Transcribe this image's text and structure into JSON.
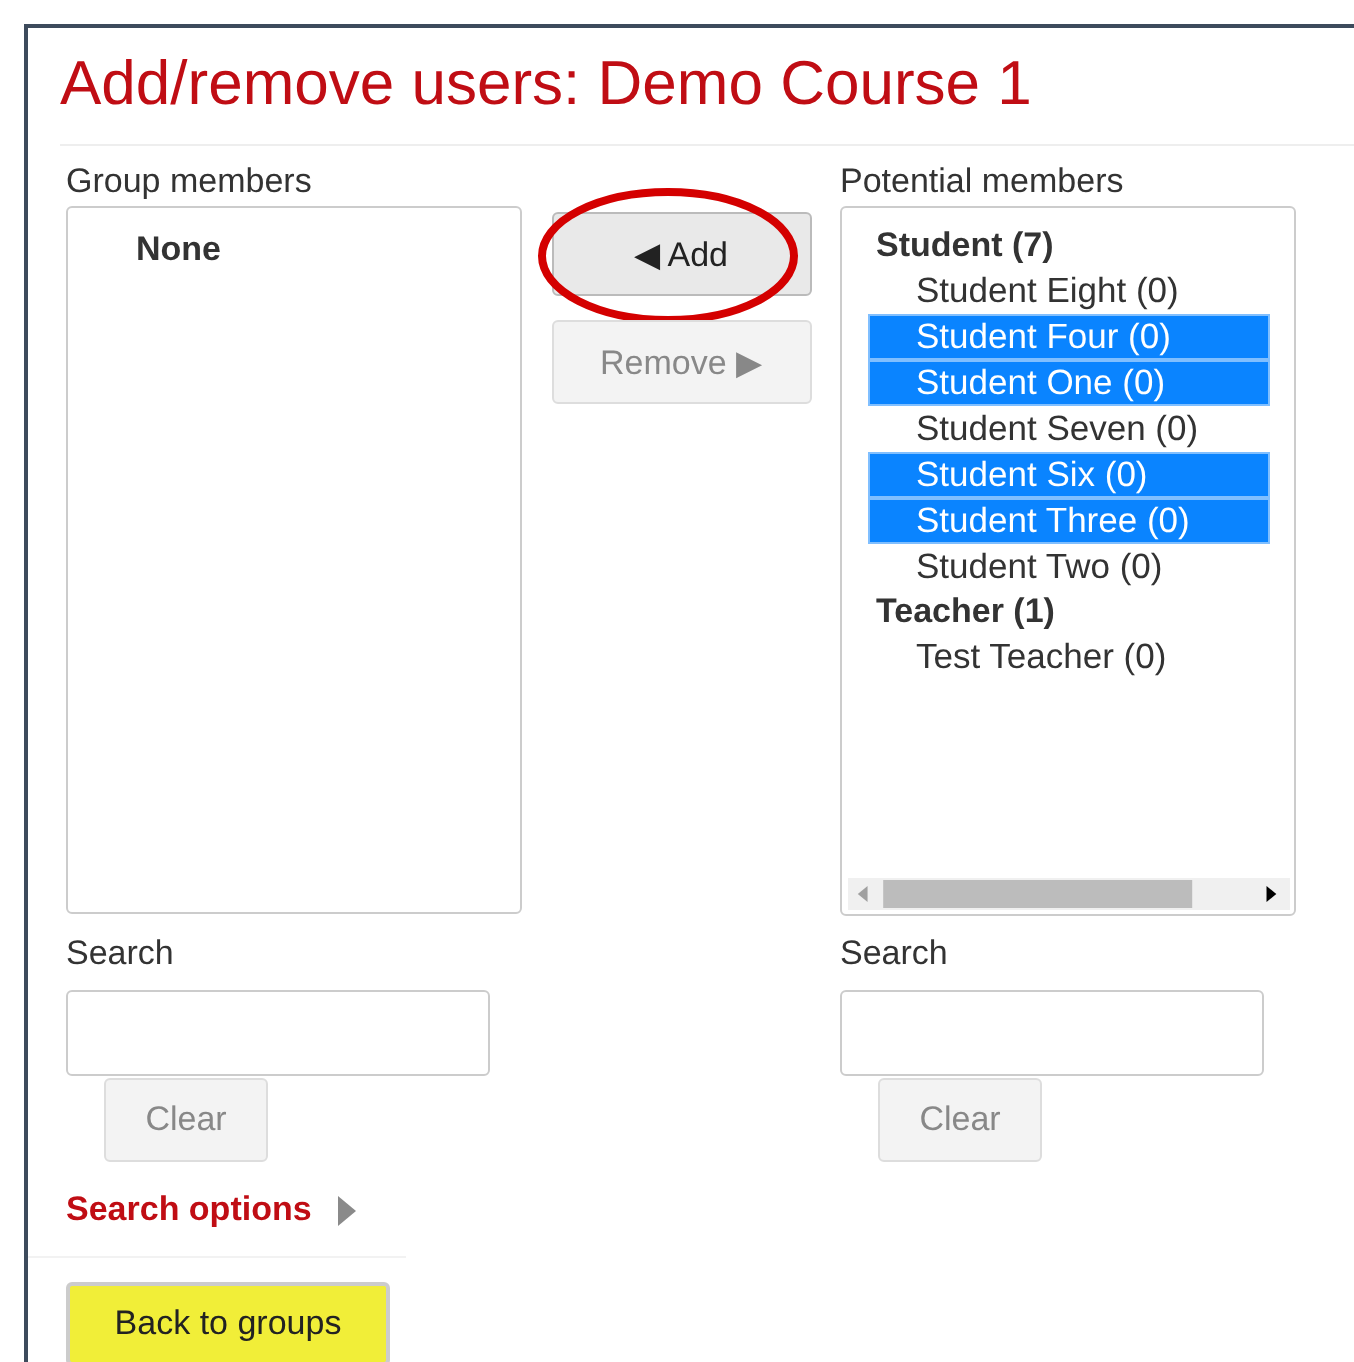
{
  "title": "Add/remove users: Demo Course 1",
  "group_members": {
    "label": "Group members",
    "groups": [
      {
        "label": "None"
      }
    ]
  },
  "actions": [
    {
      "label": "◀ Add",
      "disabled": false,
      "circled": true
    },
    {
      "label": "Remove ▶",
      "disabled": true,
      "circled": false
    }
  ],
  "potential_members": {
    "label": "Potential members",
    "groups": [
      {
        "label": "Student (7)",
        "options": [
          {
            "name": "Student Eight",
            "count": "(0)",
            "selected": false
          },
          {
            "name": "Student Four",
            "count": "(0)",
            "selected": true
          },
          {
            "name": "Student One",
            "count": "(0)",
            "selected": true
          },
          {
            "name": "Student Seven",
            "count": "(0)",
            "selected": false
          },
          {
            "name": "Student Six",
            "count": "(0)",
            "selected": true
          },
          {
            "name": "Student Three",
            "count": "(0)",
            "selected": true
          },
          {
            "name": "Student Two",
            "count": "(0)",
            "selected": false
          }
        ]
      },
      {
        "label": "Teacher (1)",
        "options": [
          {
            "name": "Test Teacher",
            "count": "(0)",
            "selected": false
          }
        ]
      }
    ]
  },
  "searches": [
    {
      "label": "Search",
      "clear": "Clear"
    },
    {
      "label": "Search",
      "clear": "Clear"
    }
  ],
  "search_options": "Search options",
  "back_button": {
    "label": "Back to groups",
    "highlighted": true
  }
}
